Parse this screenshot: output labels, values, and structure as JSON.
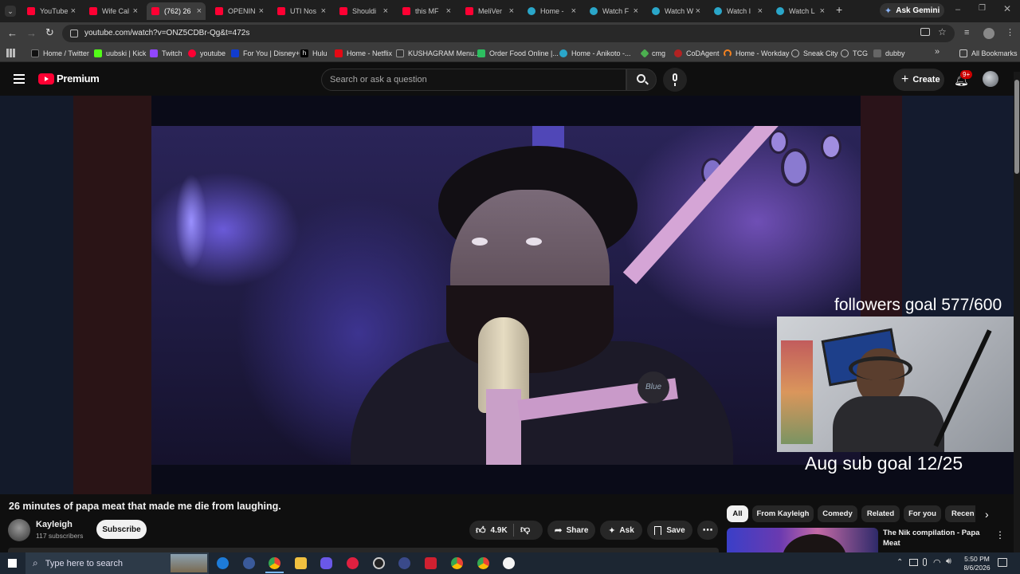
{
  "browser": {
    "tabs": [
      {
        "title": "YouTube",
        "icon": "youtube-icon"
      },
      {
        "title": "Wife Cal",
        "icon": "youtube-icon"
      },
      {
        "title": "(762) 26",
        "icon": "youtube-icon",
        "active": true
      },
      {
        "title": "OPENIN",
        "icon": "youtube-icon"
      },
      {
        "title": "UTI Nos",
        "icon": "youtube-icon"
      },
      {
        "title": "Shouldi",
        "icon": "youtube-icon"
      },
      {
        "title": "this MF",
        "icon": "youtube-icon"
      },
      {
        "title": "MeliVer",
        "icon": "youtube-icon"
      },
      {
        "title": "Home -",
        "icon": "anikoto-icon"
      },
      {
        "title": "Watch F",
        "icon": "anikoto-icon"
      },
      {
        "title": "Watch W",
        "icon": "anikoto-icon"
      },
      {
        "title": "Watch I",
        "icon": "anikoto-icon"
      },
      {
        "title": "Watch L",
        "icon": "anikoto-icon"
      }
    ],
    "ask_gemini": "Ask Gemini",
    "url": "youtube.com/watch?v=ONZ5CDBr-Qg&t=472s",
    "bookmarks": [
      {
        "label": "Home / Twitter",
        "color": "#111111"
      },
      {
        "label": "uubski | Kick",
        "color": "#53fc18"
      },
      {
        "label": "Twitch",
        "color": "#9146ff"
      },
      {
        "label": "youtube",
        "color": "#ff0033"
      },
      {
        "label": "For You | Disney+",
        "color": "#113ccf"
      },
      {
        "label": "Hulu",
        "color": "#1ce783"
      },
      {
        "label": "Home - Netflix",
        "color": "#e50914"
      },
      {
        "label": "KUSHAGRAM Menu...",
        "color": "#222222"
      },
      {
        "label": "Order Food Online |...",
        "color": "#2dbe60"
      },
      {
        "label": "Home - Anikoto -...",
        "color": "#2aa6c9"
      },
      {
        "label": "cmg",
        "color": "#4caf50"
      },
      {
        "label": "CoDAgent",
        "color": "#b22222"
      },
      {
        "label": "Home - Workday",
        "color": "#f58220"
      },
      {
        "label": "Sneak City",
        "color": "#888888"
      },
      {
        "label": "TCG",
        "color": "#888888"
      },
      {
        "label": "dubby",
        "color": "#666666"
      }
    ],
    "all_bookmarks": "All Bookmarks"
  },
  "youtube": {
    "logo_text": "Premium",
    "search_placeholder": "Search or ask a question",
    "create_label": "Create",
    "notification_badge": "9+"
  },
  "video": {
    "overlay_followers": "followers goal 577/600",
    "overlay_subs": "Aug sub goal 12/25",
    "mic_brand": "Blue",
    "title": "26 minutes of papa meat that made me die from laughing.",
    "channel_name": "Kayleigh",
    "subscribers": "117 subscribers",
    "subscribe_label": "Subscribe",
    "likes": "4.9K",
    "share_label": "Share",
    "ask_label": "Ask",
    "save_label": "Save"
  },
  "sidebar": {
    "chips": [
      "All",
      "From Kayleigh",
      "Comedy",
      "Related",
      "For you",
      "Recen"
    ],
    "recommended": [
      {
        "title": "The Nik compilation - Papa Meat"
      }
    ]
  },
  "taskbar": {
    "search_placeholder": "Type here to search",
    "time": "5:50 PM",
    "date": "8/6/2026"
  }
}
